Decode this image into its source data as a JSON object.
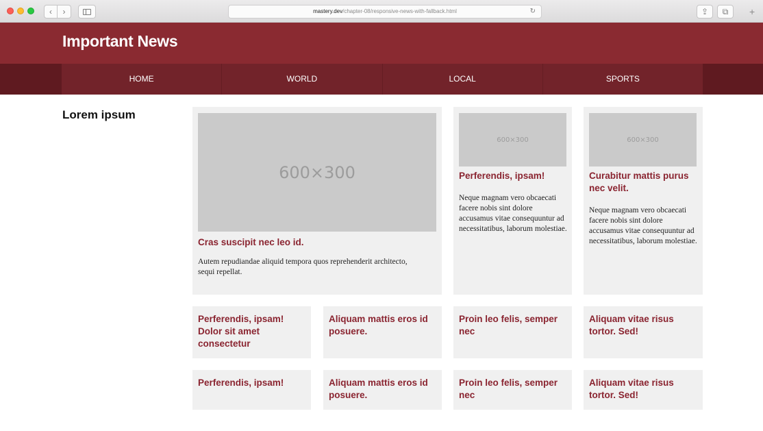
{
  "browser": {
    "url_host": "mastery.dev",
    "url_path": "/chapter-08/responsive-news-with-fallback.html",
    "nav_back": "‹",
    "nav_forward": "›",
    "reload": "↻",
    "share": "⇪",
    "tabs": "⧉",
    "new_tab": "+"
  },
  "site": {
    "title": "Important News",
    "nav": [
      "HOME",
      "WORLD",
      "LOCAL",
      "SPORTS"
    ]
  },
  "main": {
    "section_title": "Lorem ipsum",
    "featured": {
      "image_label": "600×300",
      "title": "Cras suscipit nec leo id.",
      "text": "Autem repudiandae aliquid tempora quos reprehenderit architecto, sequi repellat."
    },
    "side_cards": [
      {
        "image_label": "600×300",
        "title": "Perferendis, ipsam!",
        "text": "Neque magnam vero obcaecati facere nobis sint dolore accusamus vitae consequuntur ad necessitatibus, laborum molestiae."
      },
      {
        "image_label": "600×300",
        "title": "Curabitur mattis purus nec velit.",
        "text": "Neque magnam vero obcaecati facere nobis sint dolore accusamus vitae consequuntur ad necessitatibus, laborum molestiae."
      }
    ],
    "row1": [
      "Perferendis, ipsam! Dolor sit amet consectetur",
      "Aliquam mattis eros id posuere.",
      "Proin leo felis, semper nec",
      "Aliquam vitae risus tortor. Sed!"
    ],
    "row2": [
      "Perferendis, ipsam!",
      "Aliquam mattis eros id posuere.",
      "Proin leo felis, semper nec",
      "Aliquam vitae risus tortor. Sed!"
    ]
  }
}
